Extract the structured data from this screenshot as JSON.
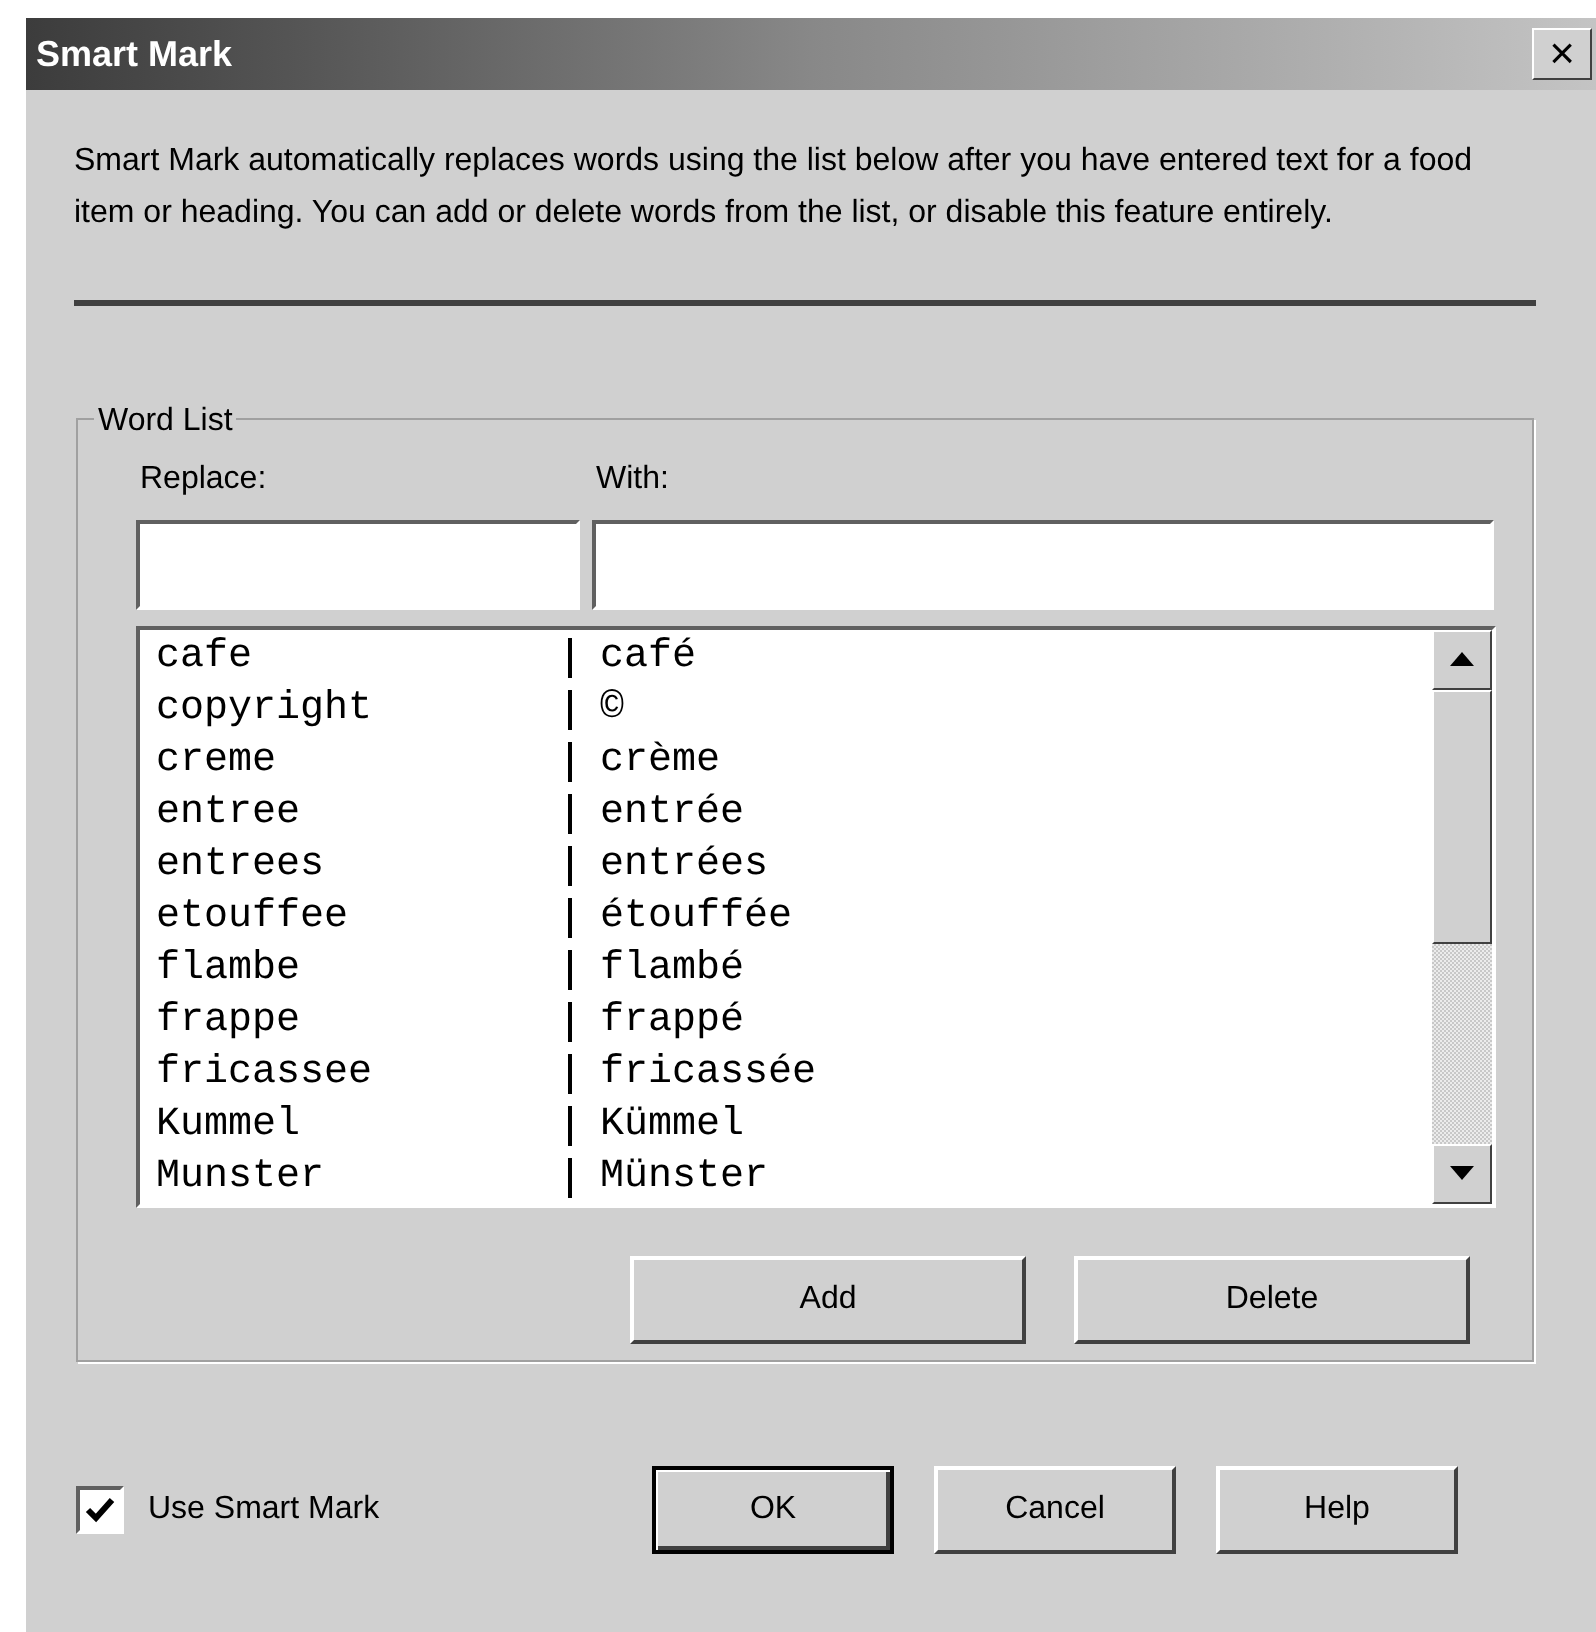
{
  "window": {
    "title": "Smart Mark",
    "close": "×"
  },
  "description": "Smart Mark automatically replaces words using the list below after you have entered text for a food item or heading. You can add or delete words from the list, or disable this feature entirely.",
  "word_list": {
    "title": "Word List",
    "replace_label": "Replace:",
    "with_label": "With:",
    "rows": [
      {
        "replace": "cafe",
        "with": "café",
        "selected": false
      },
      {
        "replace": "copyright",
        "with": "©",
        "selected": false
      },
      {
        "replace": "creme",
        "with": "crème",
        "selected": false
      },
      {
        "replace": "entree",
        "with": "entrée",
        "selected": false
      },
      {
        "replace": "entrees",
        "with": "entrées",
        "selected": false
      },
      {
        "replace": "etouffee",
        "with": "étouffée",
        "selected": false
      },
      {
        "replace": "flambe",
        "with": "flambé",
        "selected": false
      },
      {
        "replace": "frappe",
        "with": "frappé",
        "selected": false
      },
      {
        "replace": "fricassee",
        "with": "fricassée",
        "selected": false
      },
      {
        "replace": "Kummel",
        "with": "Kümmel",
        "selected": false
      },
      {
        "replace": "Munster",
        "with": "Münster",
        "selected": false
      }
    ],
    "buttons": [
      "Add",
      "Delete"
    ]
  },
  "use_smart_mark": {
    "label": "Use Smart Mark",
    "checked": true
  },
  "buttons": [
    {
      "label": "OK",
      "default": true
    },
    {
      "label": "Cancel",
      "default": false
    },
    {
      "label": "Help",
      "default": false
    }
  ]
}
